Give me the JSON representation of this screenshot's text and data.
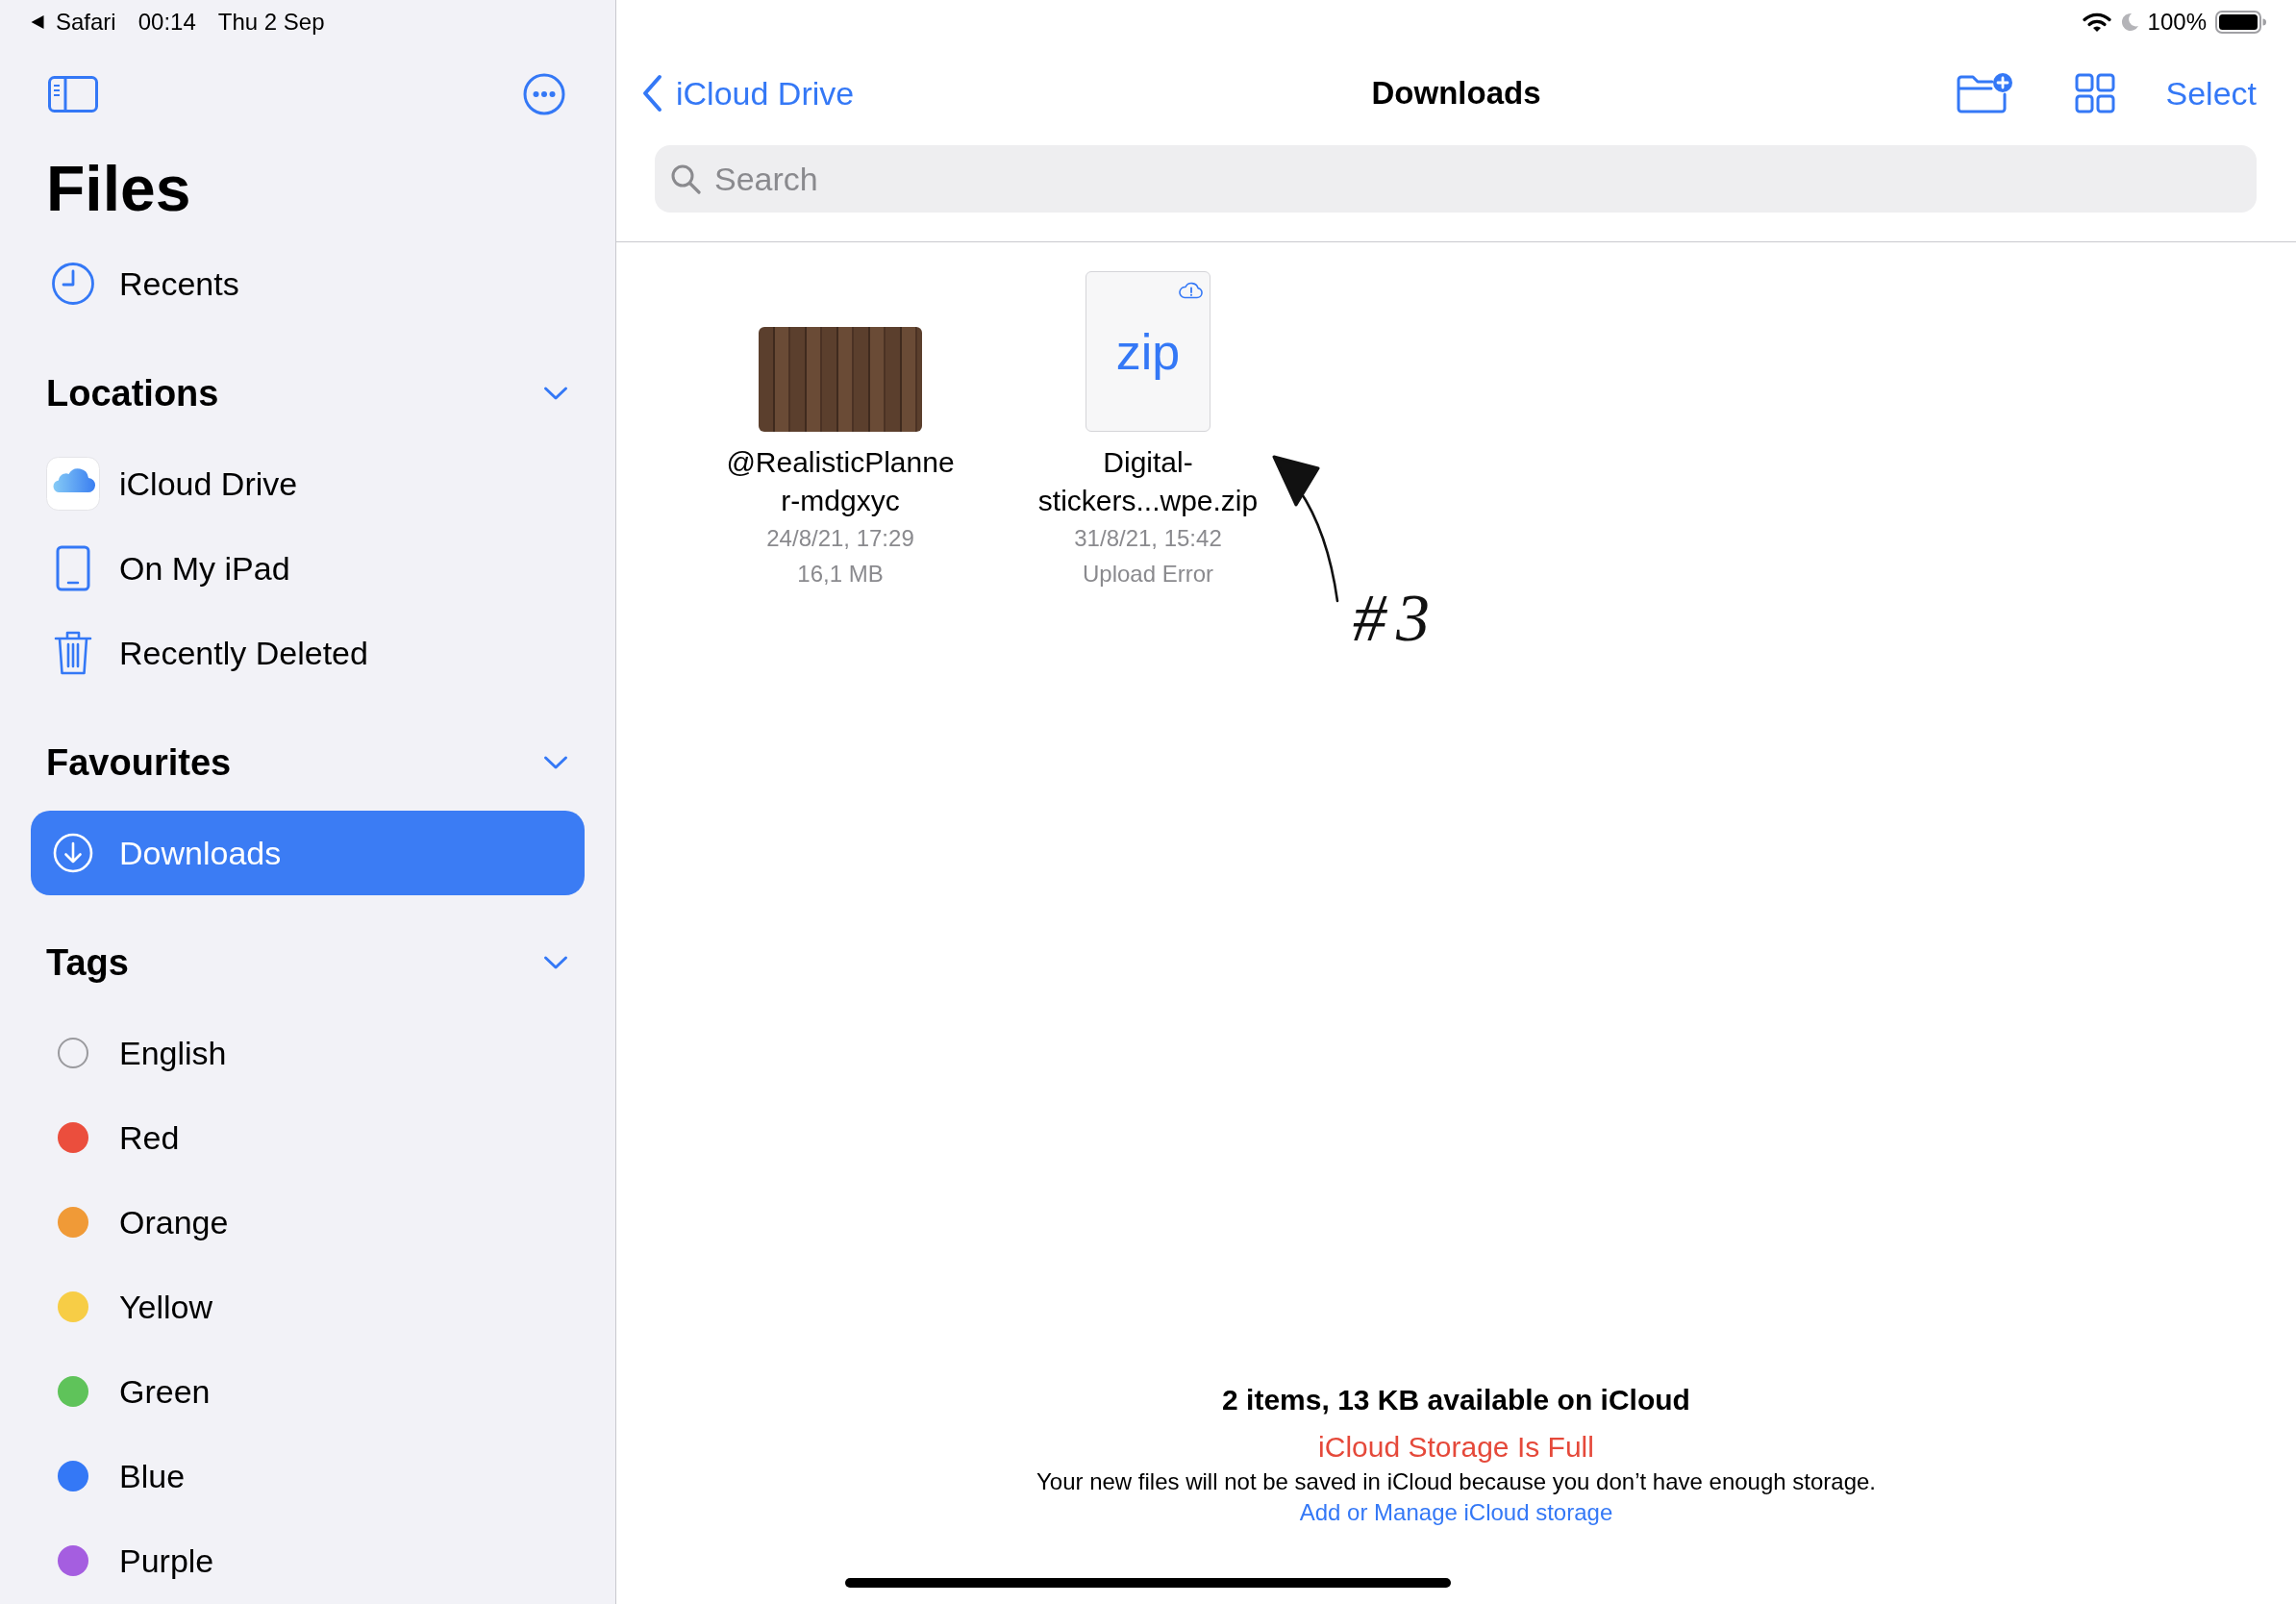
{
  "status_bar": {
    "back_app": "Safari",
    "time": "00:14",
    "date": "Thu 2 Sep",
    "battery": "100%"
  },
  "sidebar": {
    "title": "Files",
    "sections": [
      {
        "kind": "places",
        "items": [
          {
            "label": "Recents",
            "selected": false
          }
        ]
      },
      {
        "kind": "places",
        "header": "Locations",
        "expanded": true,
        "items": [
          {
            "label": "iCloud Drive",
            "selected": false
          },
          {
            "label": "On My iPad",
            "selected": false
          },
          {
            "label": "Recently Deleted",
            "selected": false
          }
        ]
      },
      {
        "kind": "places",
        "header": "Favourites",
        "expanded": true,
        "items": [
          {
            "label": "Downloads",
            "selected": true
          }
        ]
      },
      {
        "kind": "tags",
        "header": "Tags",
        "expanded": true,
        "items": [
          {
            "label": "English",
            "selected": false
          },
          {
            "label": "Red",
            "selected": false,
            "color": "#eb4e3d"
          },
          {
            "label": "Orange",
            "selected": false,
            "color": "#f09a37"
          },
          {
            "label": "Yellow",
            "selected": false,
            "color": "#f7cd46"
          },
          {
            "label": "Green",
            "selected": false,
            "color": "#5fc35a"
          },
          {
            "label": "Blue",
            "selected": false,
            "color": "#3478f6"
          },
          {
            "label": "Purple",
            "selected": false,
            "color": "#a55ee0"
          }
        ]
      }
    ]
  },
  "navigation": {
    "back": "iCloud Drive",
    "title": "Downloads",
    "select": "Select"
  },
  "search": {
    "placeholder": "Search"
  },
  "files": [
    {
      "kind": "photo",
      "name": "@RealisticPlanner-mdgxyc",
      "date": "24/8/21, 17:29",
      "size": "16,1 MB",
      "upload_error": false
    },
    {
      "kind": "document",
      "type_label": "zip",
      "name": "Digital-stickers...wpe.zip",
      "date": "31/8/21, 15:42",
      "status": "Upload Error",
      "upload_error": true
    }
  ],
  "annotation": {
    "label": "#3"
  },
  "footer": {
    "summary": "2 items, 13 KB available on iCloud",
    "warning_title": "iCloud Storage Is Full",
    "warning_text": "Your new files will not be saved in iCloud because you don’t have enough storage.",
    "link": "Add or Manage iCloud storage"
  }
}
